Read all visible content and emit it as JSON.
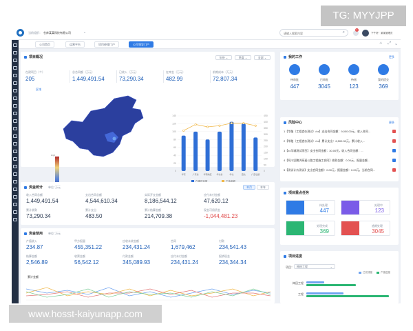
{
  "watermark_top": "TG: MYYJPP",
  "watermark_bottom": "www.hosst-kaiyunapp.com",
  "topbar": {
    "location_label": "当前组织：",
    "org_name": "仓库某某科技有限公司",
    "search_placeholder": "请输入搜索内容",
    "badge_count": "1",
    "user_name": "下午好！某某管理员"
  },
  "tabs": [
    "公司首页",
    "运营平台",
    "项目经理门户",
    "公司领导门户"
  ],
  "active_tab_index": 3,
  "overview": {
    "title": "项目概况",
    "select_year": "年份",
    "select_month": "季度",
    "select_all": "全部",
    "stats": [
      {
        "label": "在建项目（个）",
        "value": "205"
      },
      {
        "label": "总合同额（万元）",
        "value": "1,449,491.54"
      },
      {
        "label": "已收入（万元）",
        "value": "73,290.34"
      },
      {
        "label": "在库金（万元）",
        "value": "482.99"
      },
      {
        "label": "前期成本（万元）",
        "value": "72,807.34"
      }
    ],
    "map_title": "区域",
    "legend_high": "High",
    "legend_low": "Low"
  },
  "chart_data": {
    "type": "bar",
    "categories": [
      "华东",
      "广东省",
      "华南地区",
      "华北省",
      "华北",
      "西北",
      "广西壮族自治区"
    ],
    "series": [
      {
        "name": "在建项目数",
        "values": [
          90,
          100,
          80,
          100,
          125,
          120,
          85
        ]
      },
      {
        "name": "产值金额",
        "values": [
          330,
          380,
          360,
          370,
          390,
          390,
          370
        ]
      }
    ],
    "ylim_left": [
      0,
      140
    ],
    "ylim_right": [
      0,
      450
    ],
    "left_ticks": [
      "140",
      "120",
      "100",
      "80",
      "60",
      "40",
      "20",
      "0"
    ],
    "right_ticks": [
      "450",
      "400",
      "350",
      "300",
      "250",
      "200",
      "150",
      "100",
      "50",
      "0"
    ],
    "colors": [
      "#2f6fd6",
      "#f0b84a"
    ]
  },
  "work": {
    "title": "我的工作",
    "more": "更多",
    "items": [
      {
        "label": "待审批",
        "value": "447"
      },
      {
        "label": "已审批",
        "value": "3045"
      },
      {
        "label": "待阅",
        "value": "123"
      },
      {
        "label": "我的提交",
        "value": "369"
      }
    ]
  },
  "risk": {
    "title": "风险中心",
    "more": "更多",
    "rows": [
      {
        "text": "1【华融（工程造价测试）/xx】支出合同金额：9,000.00元，收入合同...",
        "color": "#e35151"
      },
      {
        "text": "2【华融（工程造价测试）/xx】累计支出：6,500.00元，累计收入...",
        "color": "#e35151"
      },
      {
        "text": "3【xx华城测试项目】支出合同金额：30.00元，收入合同金额：...",
        "color": "#2f7be5"
      },
      {
        "text": "4【阿川坚鹏洪高速公路工程施工合同】收款金额：0.00元，报量金额...",
        "color": "#2f7be5"
      },
      {
        "text": "5【测试计价测试】支出合同金额：0.00元，报量金额：0.00元，当前合同...",
        "color": "#e35151"
      }
    ]
  },
  "tasks": {
    "title": "项目重点任务",
    "items": [
      {
        "label": "待处理",
        "value": "447",
        "color": "#2f7be5"
      },
      {
        "label": "处理中",
        "value": "123",
        "color": "#7a5be8"
      },
      {
        "label": "处理完成",
        "value": "369",
        "color": "#2bb673"
      },
      {
        "label": "逾期处理",
        "value": "3045",
        "color": "#e35151"
      }
    ]
  },
  "progress": {
    "title": "项目进度",
    "select_label": "项目：",
    "select_value": "梅田工程",
    "legend": [
      "已完成度",
      "产值进度"
    ],
    "rows": [
      {
        "label": "梅田工程",
        "values": [
          0.22,
          0.6
        ]
      },
      {
        "label": "工程",
        "values": [
          0.45,
          1.0
        ]
      }
    ]
  },
  "funds_stats": {
    "title": "资金统计",
    "unit": "单位：",
    "unit_value": "万元",
    "btn_month": "本月",
    "btn_year": "本年",
    "stats": [
      {
        "label": "收入合同总额",
        "value": "1,449,491.54"
      },
      {
        "label": "支出合同总额",
        "value": "4,544,610.34"
      },
      {
        "label": "实际开支金额",
        "value": "8,186,544.12"
      },
      {
        "label": "应付未付金额",
        "value": "47,620.12"
      },
      {
        "label": "累计收款",
        "value": "73,290.34"
      },
      {
        "label": "累计支出",
        "value": "483.50"
      },
      {
        "label": "累计结算金额",
        "value": "214,709.38"
      },
      {
        "label": "现金可用资金",
        "value": "-1,044,481.23"
      }
    ]
  },
  "funds_use": {
    "title": "资金使用",
    "unit": "单位：",
    "unit_value": "万元",
    "stats": [
      {
        "label": "产值收入",
        "value": "234.87"
      },
      {
        "label": "甲方报量",
        "value": "455,351.22"
      },
      {
        "label": "应收未收金额",
        "value": "234,431.24"
      },
      {
        "label": "合同",
        "value": "1,679,462"
      },
      {
        "label": "付款",
        "value": "234,541.43"
      },
      {
        "label": "结算金额",
        "value": "2,546.89"
      },
      {
        "label": "收票金额",
        "value": "56,542.12"
      },
      {
        "label": "付款金额",
        "value": "345,089.93"
      },
      {
        "label": "应付未付金额",
        "value": "234,431.24"
      },
      {
        "label": "报销现金",
        "value": "234,344.34"
      }
    ],
    "line_title": "累计金额"
  }
}
